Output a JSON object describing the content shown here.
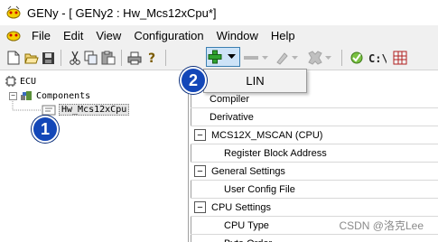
{
  "window": {
    "title": "GENy - [ GENy2 : Hw_Mcs12xCpu*]"
  },
  "menu": [
    "File",
    "Edit",
    "View",
    "Configuration",
    "Window",
    "Help"
  ],
  "toolbar": {
    "buttons": [
      "new-file",
      "open-folder",
      "save",
      "cut",
      "copy",
      "paste",
      "print",
      "help",
      "add-component",
      "add-dropdown",
      "remove",
      "edit",
      "generate",
      "validate",
      "command-line",
      "settings"
    ],
    "dropdown_open": true
  },
  "popup": {
    "item": "LIN"
  },
  "tree": {
    "root": "ECU",
    "components": "Components",
    "selected": "Hw_Mcs12xCpu"
  },
  "grid": {
    "rows": [
      {
        "kind": "item",
        "label": "Compiler"
      },
      {
        "kind": "item",
        "label": "Derivative"
      },
      {
        "kind": "section",
        "label": "MCS12X_MSCAN (CPU)"
      },
      {
        "kind": "child",
        "label": "Register Block Address"
      },
      {
        "kind": "section",
        "label": "General Settings"
      },
      {
        "kind": "child",
        "label": "User Config File"
      },
      {
        "kind": "section",
        "label": "CPU Settings"
      },
      {
        "kind": "child",
        "label": "CPU Type"
      },
      {
        "kind": "child",
        "label": "Byte Order"
      }
    ],
    "collapse_symbol": "−"
  },
  "annotations": {
    "badge1": "1",
    "badge2": "2"
  },
  "watermark": "CSDN @洛克Lee",
  "colors": {
    "badge": "#1347b8",
    "selection": "#cde3f7"
  }
}
